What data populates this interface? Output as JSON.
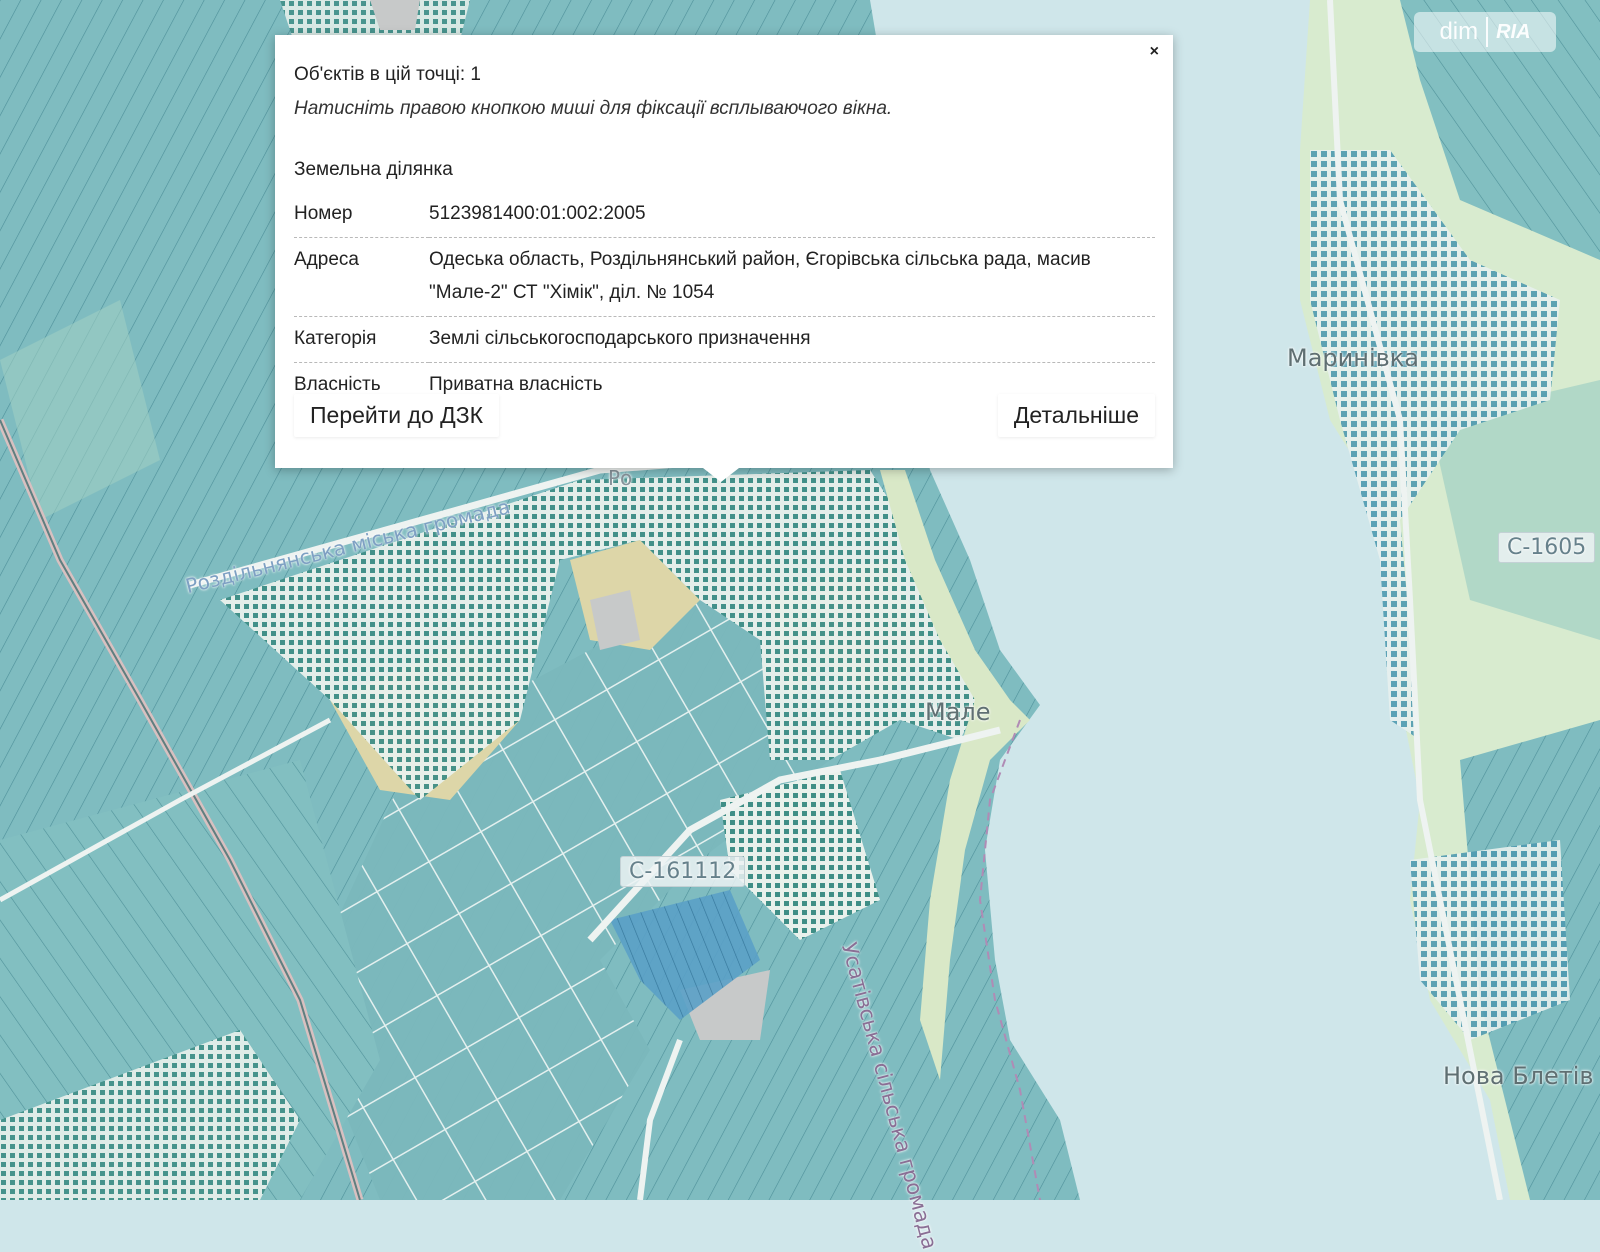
{
  "map": {
    "labels": {
      "village_marynivka": "Маринівка",
      "village_nova_bletiv": "Нова Блетів",
      "village_male": "Мале",
      "hromada_usativska": "Усатівська сільська громада",
      "hromada_rozdilnianska": "Роздільнянська міська громада",
      "road_c161112": "С-161112",
      "road_c605": "С-1605",
      "small_label": "Ро"
    },
    "colors": {
      "water": "#cfe6ea",
      "parcel_fill": "#7fbcc0",
      "parcel_stroke": "#4d8f99",
      "farmland": "#d8ebcf",
      "sand": "#ddd6a8",
      "highlight": "#3d8fc0",
      "gray_area": "#c7c9c9"
    }
  },
  "watermark": {
    "left": "dim",
    "right": "RIA"
  },
  "popup": {
    "close_label": "×",
    "count_text": "Об'єктів в цій точці: 1",
    "hint_text": "Натисніть правою кнопкою миші для фіксації всплываючого вікна.",
    "title": "Земельна ділянка",
    "rows": [
      {
        "key": "Номер",
        "value": "5123981400:01:002:2005"
      },
      {
        "key": "Адреса",
        "value": "Одеська область, Роздільнянський район, Єгорівська сільська рада, масив \"Мале-2\" СТ \"Хімік\", діл. № 1054"
      },
      {
        "key": "Категорія",
        "value": "Землі сільськогосподарського призначення"
      },
      {
        "key": "Власність",
        "value": "Приватна власність"
      }
    ],
    "action_left": "Перейти до ДЗК",
    "action_right": "Детальніше"
  }
}
